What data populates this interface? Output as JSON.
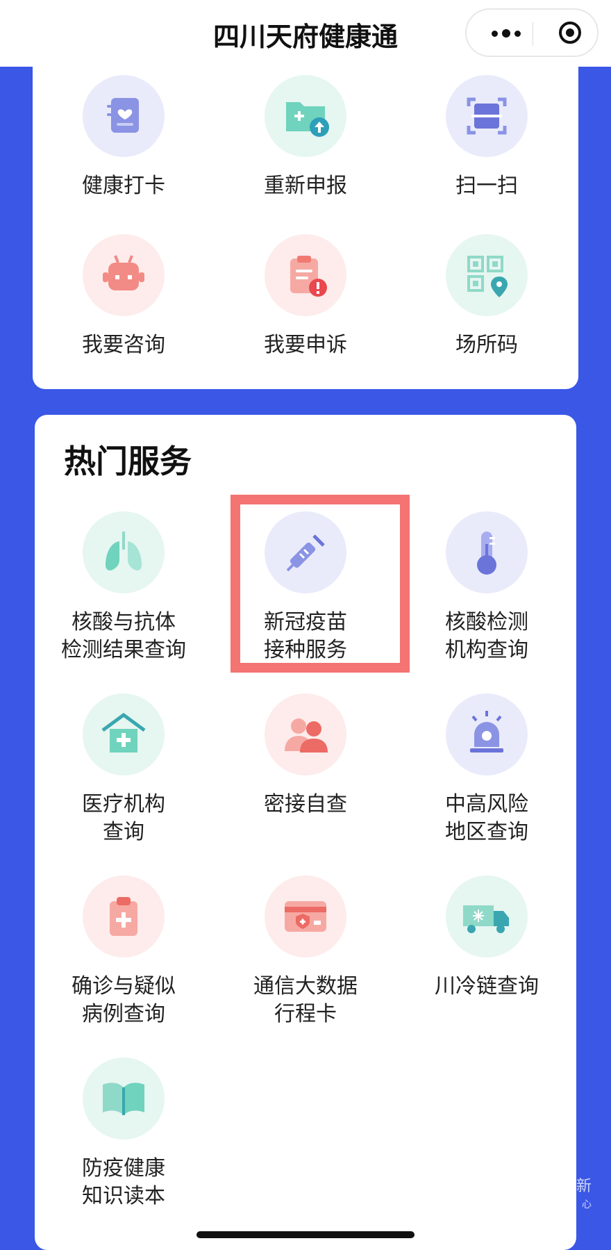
{
  "app": {
    "title": "四川天府健康通"
  },
  "top_grid": [
    {
      "label": "健康打卡",
      "icon": "health-checkin-icon"
    },
    {
      "label": "重新申报",
      "icon": "folder-upload-icon"
    },
    {
      "label": "扫一扫",
      "icon": "scan-icon"
    },
    {
      "label": "我要咨询",
      "icon": "robot-icon"
    },
    {
      "label": "我要申诉",
      "icon": "clipboard-alert-icon"
    },
    {
      "label": "场所码",
      "icon": "qr-location-icon"
    }
  ],
  "hot_services": {
    "title": "热门服务",
    "items": [
      {
        "label": "核酸与抗体\n检测结果查询",
        "icon": "lungs-icon"
      },
      {
        "label": "新冠疫苗\n接种服务",
        "icon": "syringe-icon"
      },
      {
        "label": "核酸检测\n机构查询",
        "icon": "thermometer-icon"
      },
      {
        "label": "医疗机构\n查询",
        "icon": "hospital-icon"
      },
      {
        "label": "密接自查",
        "icon": "people-icon"
      },
      {
        "label": "中高风险\n地区查询",
        "icon": "alarm-icon"
      },
      {
        "label": "确诊与疑似\n病例查询",
        "icon": "medical-clipboard-icon"
      },
      {
        "label": "通信大数据\n行程卡",
        "icon": "travel-card-icon"
      },
      {
        "label": "川冷链查询",
        "icon": "cold-chain-truck-icon"
      },
      {
        "label": "防疫健康\n知识读本",
        "icon": "book-icon"
      }
    ]
  },
  "watermark": {
    "line1": "新",
    "line2": "心"
  }
}
